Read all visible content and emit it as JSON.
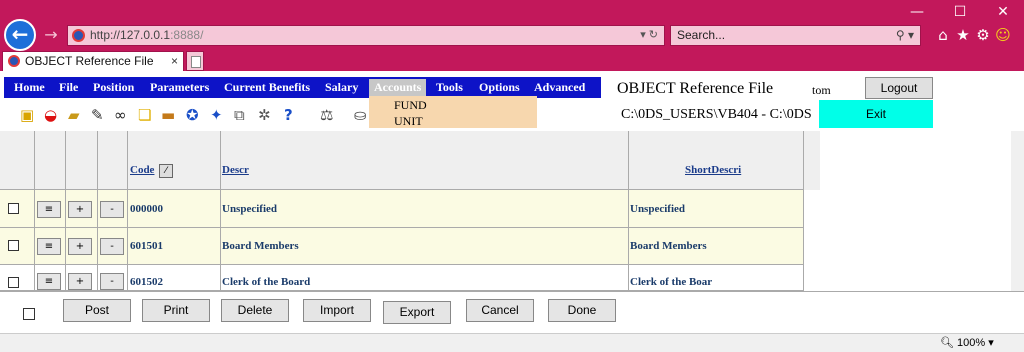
{
  "browser": {
    "url_host": "http://127.0.0.1",
    "url_rest": ":8888/",
    "search_placeholder": "Search...",
    "tab_title": "OBJECT Reference File",
    "tab_close": "×",
    "zoom": "100%"
  },
  "menu": {
    "items": [
      "Home",
      "File",
      "Position",
      "Parameters",
      "Current Benefits",
      "Salary",
      "Accounts",
      "Tools",
      "Options",
      "Advanced"
    ],
    "active": "Accounts",
    "dropdown": [
      "FUND",
      "UNIT"
    ]
  },
  "header": {
    "title": "OBJECT Reference File",
    "user": "tom",
    "path": "C:\\0DS_USERS\\VB404 - C:\\0DS",
    "logout": "Logout",
    "exit": "Exit"
  },
  "grid": {
    "columns": [
      "Code",
      "Descr",
      "ShortDescri"
    ],
    "sort_indicator": "⁄",
    "row_buttons": [
      "≡",
      "+",
      "-"
    ],
    "rows": [
      {
        "code": "000000",
        "descr": "Unspecified",
        "short": "Unspecified"
      },
      {
        "code": "601501",
        "descr": "Board Members",
        "short": "Board Members"
      },
      {
        "code": "601502",
        "descr": "Clerk of the Board",
        "short": "Clerk of the Boar"
      }
    ]
  },
  "footer": {
    "buttons": [
      "Post",
      "Print",
      "Delete",
      "Import",
      "Export",
      "Cancel",
      "Done"
    ]
  },
  "colors": {
    "chrome": "#c2185b",
    "menubar": "#0d13c7",
    "dropdown": "#f7d7ae",
    "exit": "#00ffe8",
    "row_yellow": "#fbfbe3"
  }
}
